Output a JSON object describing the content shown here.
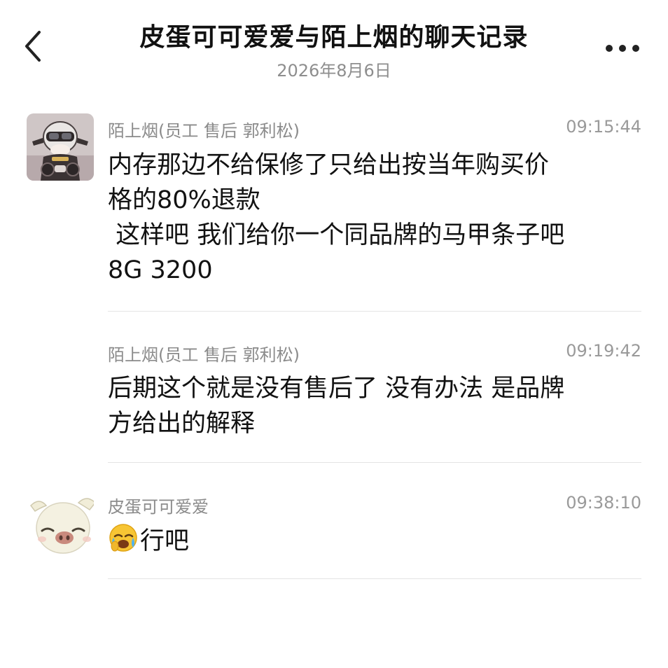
{
  "header": {
    "title": "皮蛋可可爱爱与陌上烟的聊天记录",
    "date": "2026年8月6日",
    "back_icon": "chevron-left-icon",
    "more_icon": "more-dots-icon"
  },
  "messages": [
    {
      "sender": "陌上烟(员工 售后 郭利松)",
      "time": "09:15:44",
      "avatar_icon": "motorcycle-rider-avatar",
      "lines": [
        "内存那边不给保修了只给出按当年购买价",
        "格的80%退款",
        " 这样吧 我们给你一个同品牌的马甲条子吧",
        "8G 3200"
      ]
    },
    {
      "sender": "陌上烟(员工 售后 郭利松)",
      "time": "09:19:42",
      "lines": [
        "后期这个就是没有售后了 没有办法 是品牌",
        "方给出的解释"
      ]
    },
    {
      "sender": "皮蛋可可爱爱",
      "time": "09:38:10",
      "avatar_icon": "pig-avatar",
      "emoji_icon": "crying-face-emoji",
      "lines": [
        "行吧"
      ]
    }
  ],
  "colors": {
    "title": "#111111",
    "secondary_text": "#8b8b8b",
    "divider": "#e4e4e4"
  }
}
